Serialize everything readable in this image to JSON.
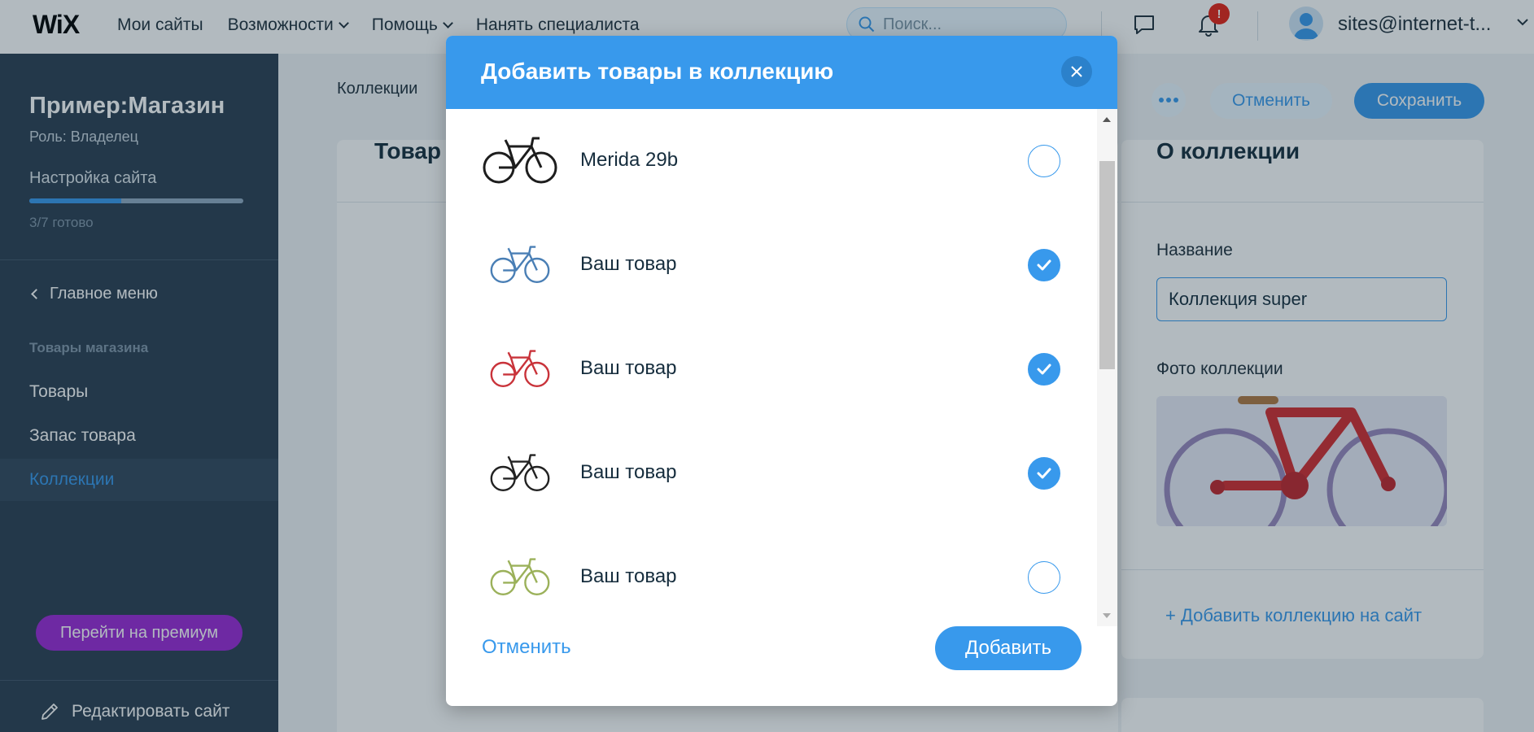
{
  "topbar": {
    "logo": "WiX",
    "nav": [
      {
        "label": "Мои сайты",
        "dropdown": false
      },
      {
        "label": "Возможности",
        "dropdown": true
      },
      {
        "label": "Помощь",
        "dropdown": true
      },
      {
        "label": "Нанять специалиста",
        "dropdown": false
      }
    ],
    "search_placeholder": "Поиск...",
    "notification_badge": "!",
    "user_email": "sites@internet-t..."
  },
  "sidebar": {
    "site_name": "Пример:Магазин",
    "role": "Роль: Владелец",
    "setup_label": "Настройка сайта",
    "setup_progress": 0.43,
    "setup_progress_text": "3/7 готово",
    "main_menu": "Главное меню",
    "section_label": "Товары магазина",
    "items": [
      {
        "label": "Товары",
        "active": false
      },
      {
        "label": "Запас товара",
        "active": false
      },
      {
        "label": "Коллекции",
        "active": true
      }
    ],
    "premium_button": "Перейти на премиум",
    "edit_site": "Редактировать сайт"
  },
  "page": {
    "breadcrumb": "Коллекции",
    "cancel_button": "Отменить",
    "save_button": "Сохранить",
    "products_title": "Товар",
    "about_title": "О коллекции",
    "name_label": "Название",
    "name_value": "Коллекция super",
    "photo_label": "Фото коллекции",
    "add_to_site": "+ Добавить коллекцию на сайт"
  },
  "modal": {
    "title": "Добавить товары в коллекцию",
    "products": [
      {
        "name": "Merida 29b",
        "checked": false,
        "color": "#1d1d1d"
      },
      {
        "name": "Ваш товар",
        "checked": true,
        "color": "#4a7fb5"
      },
      {
        "name": "Ваш товар",
        "checked": true,
        "color": "#c9333a"
      },
      {
        "name": "Ваш товар",
        "checked": true,
        "color": "#222222"
      },
      {
        "name": "Ваш товар",
        "checked": false,
        "color": "#9bb15a"
      }
    ],
    "cancel_button": "Отменить",
    "add_button": "Добавить"
  },
  "colors": {
    "accent": "#3899ec",
    "sidebar_bg": "#2b3e51",
    "premium": "#9a27d5"
  }
}
